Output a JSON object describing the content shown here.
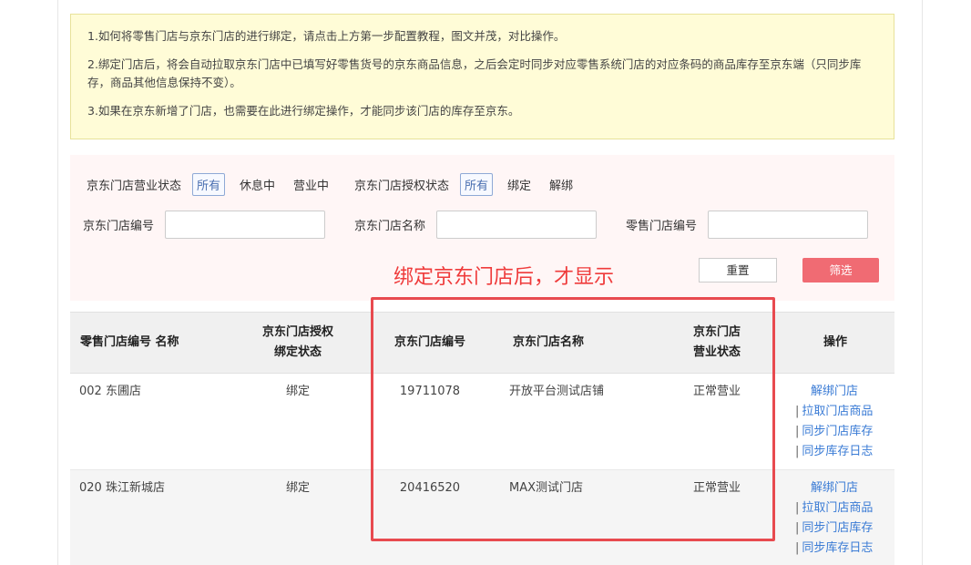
{
  "notice": {
    "lines": [
      "1.如何将零售门店与京东门店的进行绑定，请点击上方第一步配置教程，图文并茂，对比操作。",
      "2.绑定门店后，将会自动拉取京东门店中已填写好零售货号的京东商品信息，之后会定时同步对应零售系统门店的对应条码的商品库存至京东端（只同步库存，商品其他信息保持不变）。",
      "3.如果在京东新增了门店，也需要在此进行绑定操作，才能同步该门店的库存至京东。"
    ]
  },
  "filter": {
    "biz_status_label": "京东门店营业状态",
    "biz_status_options": [
      "所有",
      "休息中",
      "营业中"
    ],
    "auth_status_label": "京东门店授权状态",
    "auth_status_options": [
      "所有",
      "绑定",
      "解绑"
    ],
    "jd_store_no_label": "京东门店编号",
    "jd_store_name_label": "京东门店名称",
    "retail_store_no_label": "零售门店编号",
    "reset_label": "重置",
    "filter_label": "筛选"
  },
  "annotation": "绑定京东门店后，才显示",
  "table": {
    "headers": {
      "retail": "零售门店编号 名称",
      "auth_line1": "京东门店授权",
      "auth_line2": "绑定状态",
      "jd_no": "京东门店编号",
      "jd_name": "京东门店名称",
      "biz_line1": "京东门店",
      "biz_line2": "营业状态",
      "ops": "操作"
    },
    "rows": [
      {
        "retail": "002   东圃店",
        "auth": "绑定",
        "jd_no": "19711078",
        "jd_name": "开放平台测试店铺",
        "biz": "正常营业"
      },
      {
        "retail": "020   珠江新城店",
        "auth": "绑定",
        "jd_no": "20416520",
        "jd_name": "MAX测试门店",
        "biz": "正常营业"
      }
    ],
    "ops": {
      "unbind": "解绑门店",
      "pull": "拉取门店商品",
      "sync": "同步门店库存",
      "log": "同步库存日志",
      "sep": "|"
    }
  }
}
